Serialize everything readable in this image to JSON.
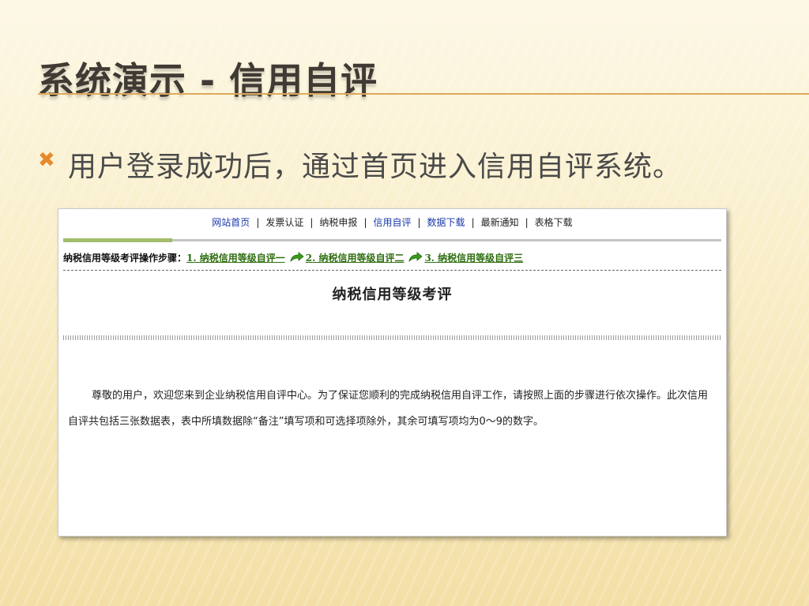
{
  "slide": {
    "title": "系统演示 - 信用自评",
    "bullet_icon": "x-mark-icon",
    "bullet_text": "用户登录成功后，通过首页进入信用自评系统。"
  },
  "colors": {
    "accent_orange": "#e58a2a",
    "title_rule": "#e0a95a",
    "link_blue": "#1a39a8",
    "step_green": "#2f6e11",
    "progress_green": "#a2bd6a"
  },
  "screenshot": {
    "nav": {
      "items": [
        {
          "label": "网站首页",
          "link": true
        },
        {
          "label": "发票认证",
          "link": false
        },
        {
          "label": "纳税申报",
          "link": false
        },
        {
          "label": "信用自评",
          "link": true
        },
        {
          "label": "数据下载",
          "link": true
        },
        {
          "label": "最新通知",
          "link": false
        },
        {
          "label": "表格下载",
          "link": false
        }
      ],
      "separator": "|"
    },
    "steps": {
      "prefix": "纳税信用等级考评操作步骤：",
      "step1": "1. 纳税信用等级自评一",
      "step2": "2. 纳税信用等级自评二",
      "step3": "3. 纳税信用等级自评三",
      "arrow_icon": "green-arrow-icon"
    },
    "form_title": "纳税信用等级考评",
    "welcome_text": "尊敬的用户，欢迎您来到企业纳税信用自评中心。为了保证您顺利的完成纳税信用自评工作，请按照上面的步骤进行依次操作。此次信用自评共包括三张数据表，表中所填数据除“备注”填写项和可选择项除外，其余可填写项均为0～9的数字。"
  }
}
